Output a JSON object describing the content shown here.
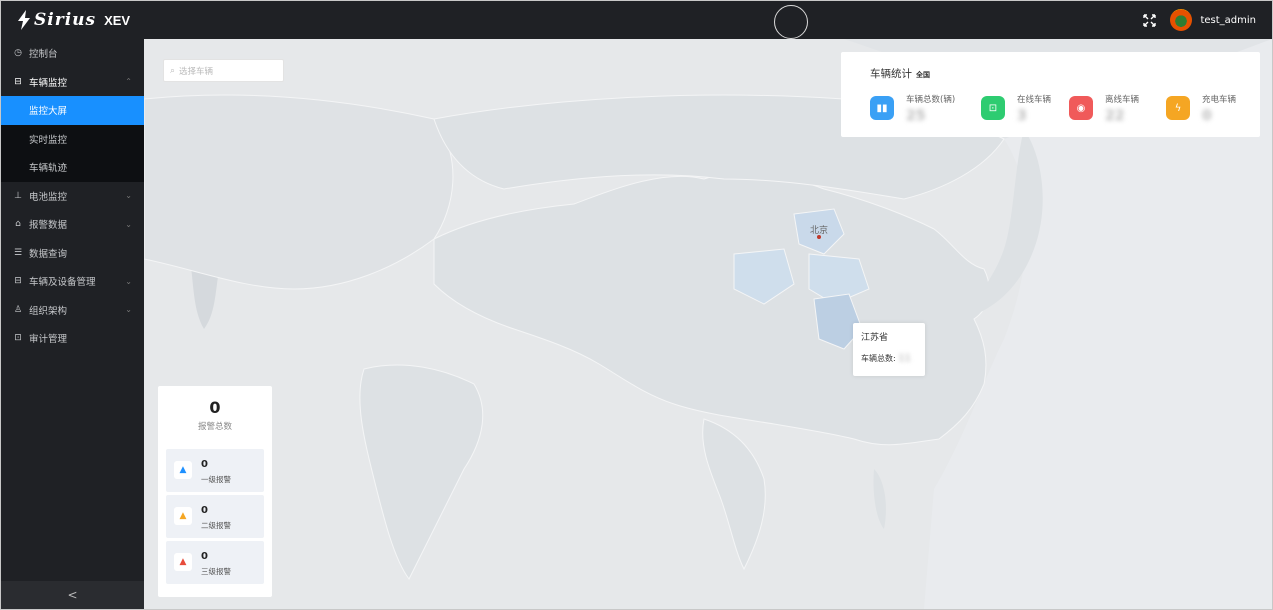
{
  "header": {
    "brand": "Sirius",
    "product": "XEV",
    "username": "test_admin"
  },
  "sidebar": {
    "items": [
      {
        "label": "控制台",
        "icon": "clock-icon"
      },
      {
        "label": "车辆监控",
        "icon": "car-icon",
        "open": true,
        "children": [
          {
            "label": "监控大屏",
            "active": true
          },
          {
            "label": "实时监控"
          },
          {
            "label": "车辆轨迹"
          }
        ]
      },
      {
        "label": "电池监控",
        "icon": "battery-icon"
      },
      {
        "label": "报警数据",
        "icon": "alarm-icon"
      },
      {
        "label": "数据查询",
        "icon": "list-icon"
      },
      {
        "label": "车辆及设备管理",
        "icon": "device-icon"
      },
      {
        "label": "组织架构",
        "icon": "user-icon"
      },
      {
        "label": "审计管理",
        "icon": "audit-icon"
      }
    ],
    "collapse_label": "<"
  },
  "map": {
    "search_placeholder": "选择车辆",
    "city_label": "北京",
    "tooltip": {
      "province": "江苏省",
      "label": "车辆总数:",
      "value": "11"
    }
  },
  "stats": {
    "title": "车辆统计",
    "scope": "全国",
    "items": [
      {
        "label": "车辆总数(辆)",
        "value": "25",
        "color": "#3aa0f5",
        "icon": "bar-chart-icon"
      },
      {
        "label": "在线车辆",
        "value": "3",
        "color": "#2ecc71",
        "icon": "car-icon"
      },
      {
        "label": "离线车辆",
        "value": "22",
        "color": "#f05a5a",
        "icon": "wifi-off-icon"
      },
      {
        "label": "充电车辆",
        "value": "0",
        "color": "#f5a623",
        "icon": "charge-icon"
      }
    ]
  },
  "alarms": {
    "total": "0",
    "total_label": "报警总数",
    "levels": [
      {
        "count": "0",
        "label": "一级报警",
        "color": "#1e90ff"
      },
      {
        "count": "0",
        "label": "二级报警",
        "color": "#f5a623"
      },
      {
        "count": "0",
        "label": "三级报警",
        "color": "#e74c3c"
      }
    ]
  }
}
